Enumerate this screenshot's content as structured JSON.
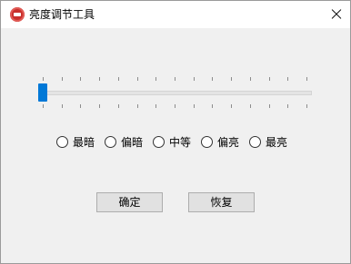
{
  "window": {
    "title": "亮度调节工具"
  },
  "slider": {
    "value_fraction": 0.0,
    "tick_count": 15
  },
  "radios": [
    {
      "label": "最暗",
      "checked": false
    },
    {
      "label": "偏暗",
      "checked": false
    },
    {
      "label": "中等",
      "checked": false
    },
    {
      "label": "偏亮",
      "checked": false
    },
    {
      "label": "最亮",
      "checked": false
    }
  ],
  "buttons": {
    "ok": "确定",
    "reset": "恢复"
  },
  "colors": {
    "accent": "#0078d7",
    "window_bg": "#f0f0f0"
  }
}
